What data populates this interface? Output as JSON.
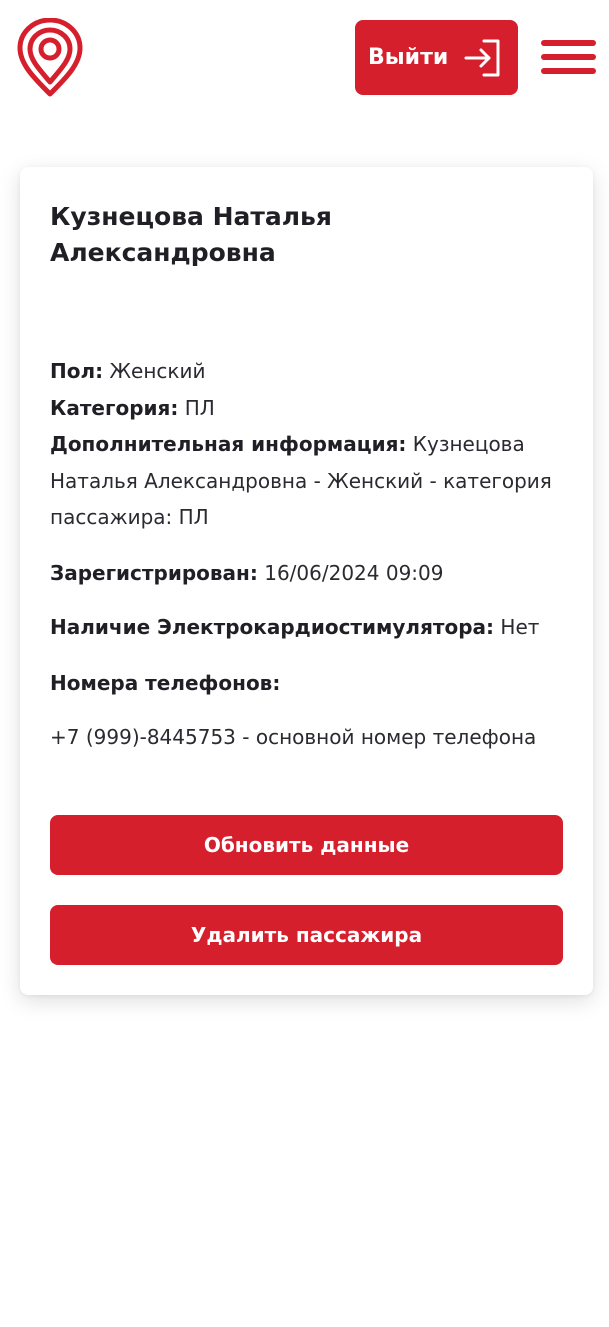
{
  "header": {
    "logo_icon": "map-pin-logo-icon",
    "logout_label": "Выйти",
    "logout_icon": "sign-in-arrow-icon",
    "menu_icon": "hamburger-menu-icon"
  },
  "passenger": {
    "full_name": "Кузнецова Наталья Александровна",
    "gender_label": "Пол:",
    "gender_value": "Женский",
    "category_label": "Категория:",
    "category_value": "ПЛ",
    "extra_label": "Дополнительная информация:",
    "extra_value": "Кузнецова Наталья Александровна - Женский - категория пассажира: ПЛ",
    "registered_label": "Зарегистрирован:",
    "registered_value": "16/06/2024 09:09",
    "pacemaker_label": "Наличие Электрокардиостимулятора:",
    "pacemaker_value": "Нет",
    "phones_label": "Номера телефонов:",
    "phones": [
      "+7 (999)-8445753 - основной номер телефона"
    ]
  },
  "actions": {
    "update_label": "Обновить данные",
    "delete_label": "Удалить пассажира"
  },
  "colors": {
    "accent": "#d51f2d",
    "text": "#1f1f25",
    "background": "#ffffff"
  }
}
